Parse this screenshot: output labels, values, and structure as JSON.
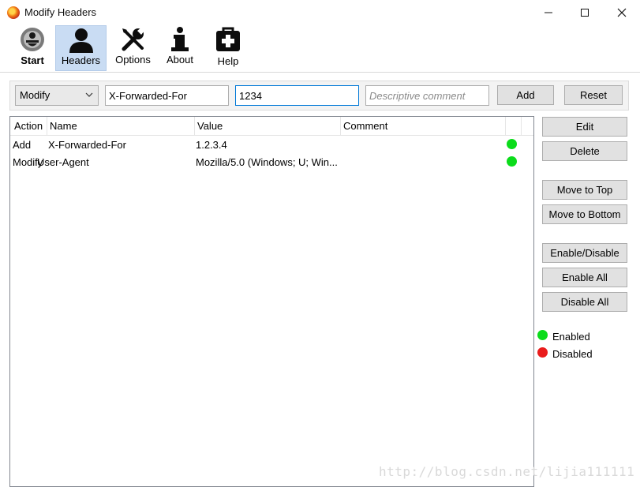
{
  "window": {
    "title": "Modify Headers",
    "controls": {
      "minimize": "minimize-icon",
      "maximize": "maximize-icon",
      "close": "close-icon"
    }
  },
  "toolbar": {
    "items": [
      {
        "label": "Start",
        "icon": "start-icon",
        "selected": false
      },
      {
        "label": "Headers",
        "icon": "person-icon",
        "selected": true
      },
      {
        "label": "Options",
        "icon": "tools-icon",
        "selected": false
      },
      {
        "label": "About",
        "icon": "info-icon",
        "selected": false
      },
      {
        "label": "Help",
        "icon": "first-aid-icon",
        "selected": false
      }
    ]
  },
  "entry": {
    "action_select": "Modify",
    "name_value": "X-Forwarded-For",
    "value_value": "1234",
    "comment_placeholder": "Descriptive comment",
    "add_label": "Add",
    "reset_label": "Reset"
  },
  "table": {
    "columns": [
      "Action",
      "Name",
      "Value",
      "Comment"
    ],
    "rows": [
      {
        "action": "Add",
        "name": "X-Forwarded-For",
        "value": "1.2.3.4",
        "comment": "",
        "status": "enabled"
      },
      {
        "action": "Modify",
        "name": "User-Agent",
        "value": "Mozilla/5.0 (Windows; U; Win...",
        "comment": "",
        "status": "enabled"
      }
    ]
  },
  "side_buttons": {
    "edit": "Edit",
    "delete": "Delete",
    "move_top": "Move to Top",
    "move_bottom": "Move to Bottom",
    "enable_disable": "Enable/Disable",
    "enable_all": "Enable All",
    "disable_all": "Disable All"
  },
  "legend": {
    "enabled_label": "Enabled",
    "disabled_label": "Disabled",
    "enabled_color": "#0bdc1b",
    "disabled_color": "#ea1c1c"
  },
  "watermark": "http://blog.csdn.net/lijia111111"
}
